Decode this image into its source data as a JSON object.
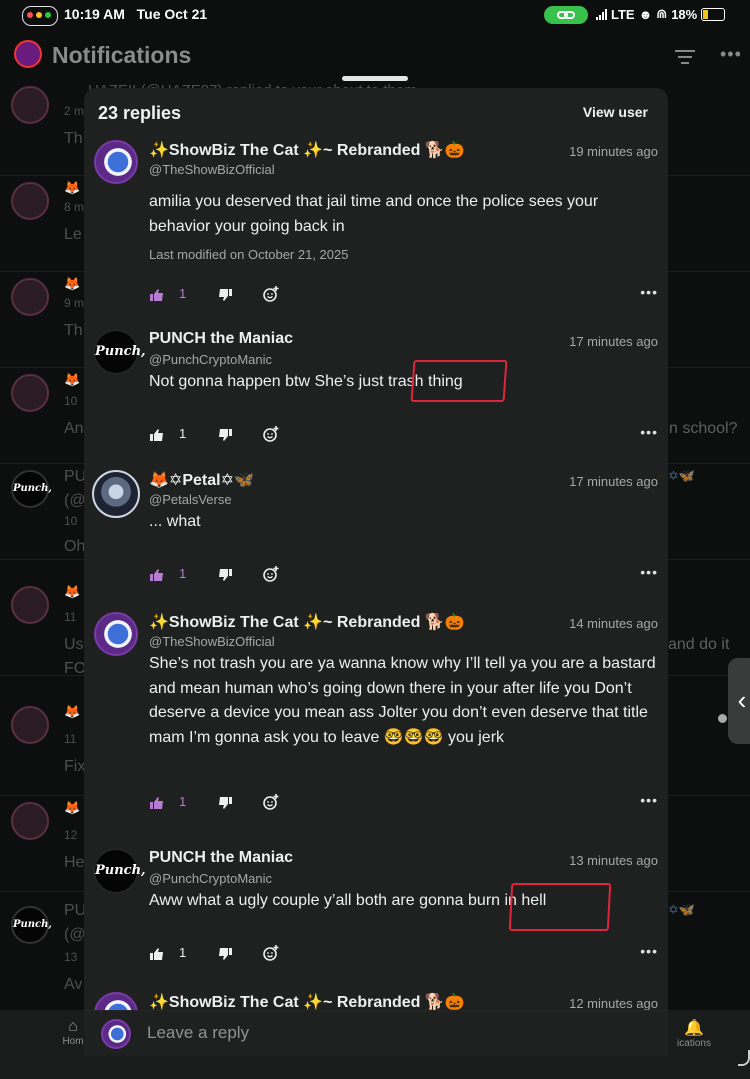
{
  "status_bar": {
    "time": "10:19 AM",
    "date": "Tue Oct 21",
    "network": "LTE",
    "battery": "18%",
    "icons": [
      "window-dots-icon",
      "link-icon",
      "signal-icon",
      "do-not-disturb-icon",
      "headphones-icon",
      "battery-charging-icon"
    ]
  },
  "background": {
    "title": "Notifications",
    "first_row_text": "HAZEII (@HAZE87) replied to your shout to them",
    "rows": [
      {
        "meta": "2 m",
        "text": "Th"
      },
      {
        "meta": "8 m",
        "text": "Le"
      },
      {
        "meta": "9 m",
        "text": "Th"
      },
      {
        "meta": "10",
        "text": "An",
        "right_text": "n school?"
      },
      {
        "name": "PU",
        "line2": "(@",
        "meta": "10",
        "text": "Oh"
      },
      {
        "meta": "11",
        "text": "Us",
        "line2": "FO",
        "right_text": "and do it"
      },
      {
        "meta": "11",
        "text": "Fix"
      },
      {
        "meta": "12",
        "text": "He"
      },
      {
        "name": "PU",
        "line2": "(@",
        "meta": "13",
        "text": "Av"
      }
    ],
    "tabs": {
      "home": "Hom",
      "notifications": "ications"
    }
  },
  "sheet": {
    "replies_count": "23 replies",
    "view_user": "View user",
    "reply_placeholder": "Leave a reply"
  },
  "comments": [
    {
      "name": "✨ShowBiz The Cat ✨~ Rebranded 🐕🎃",
      "handle": "@TheShowBizOfficial",
      "time": "19 minutes ago",
      "body": "amilia you deserved that jail time and once the police sees your behavior your going back in",
      "modified": "Last modified on October 21, 2025",
      "likes": "1",
      "liked": true
    },
    {
      "name": "PUNCH the Maniac",
      "handle": "@PunchCryptoManic",
      "time": "17 minutes ago",
      "body": "Not gonna happen btw She’s just trash thing",
      "likes": "1",
      "liked": false,
      "highlight": "trash thing"
    },
    {
      "name": "🦊✡Petal✡🦋",
      "handle": "@PetalsVerse",
      "time": "17 minutes ago",
      "body": "... what",
      "likes": "1",
      "liked": true
    },
    {
      "name": "✨ShowBiz The Cat ✨~ Rebranded 🐕🎃",
      "handle": "@TheShowBizOfficial",
      "time": "14 minutes ago",
      "body": "She’s not trash you are ya wanna know why I’ll tell ya you are a bastard and mean human who’s going down there in your after life you Don’t deserve a device you mean ass Jolter you don’t even deserve that title mam I’m gonna ask you to leave 🤓🤓🤓 you jerk",
      "likes": "1",
      "liked": true
    },
    {
      "name": "PUNCH the Maniac",
      "handle": "@PunchCryptoManic",
      "time": "13 minutes ago",
      "body": "Aww what a ugly couple y’all both are gonna burn in hell",
      "likes": "1",
      "liked": false,
      "highlight": "burn in hell"
    },
    {
      "name": "✨ShowBiz The Cat ✨~ Rebranded 🐕🎃",
      "time": "12 minutes ago"
    }
  ],
  "colors": {
    "background": "#0d0e0e",
    "sheet": "#1e211f",
    "liked": "#b67cd2",
    "annotation": "#e0243d",
    "status_green": "#39c24b"
  }
}
